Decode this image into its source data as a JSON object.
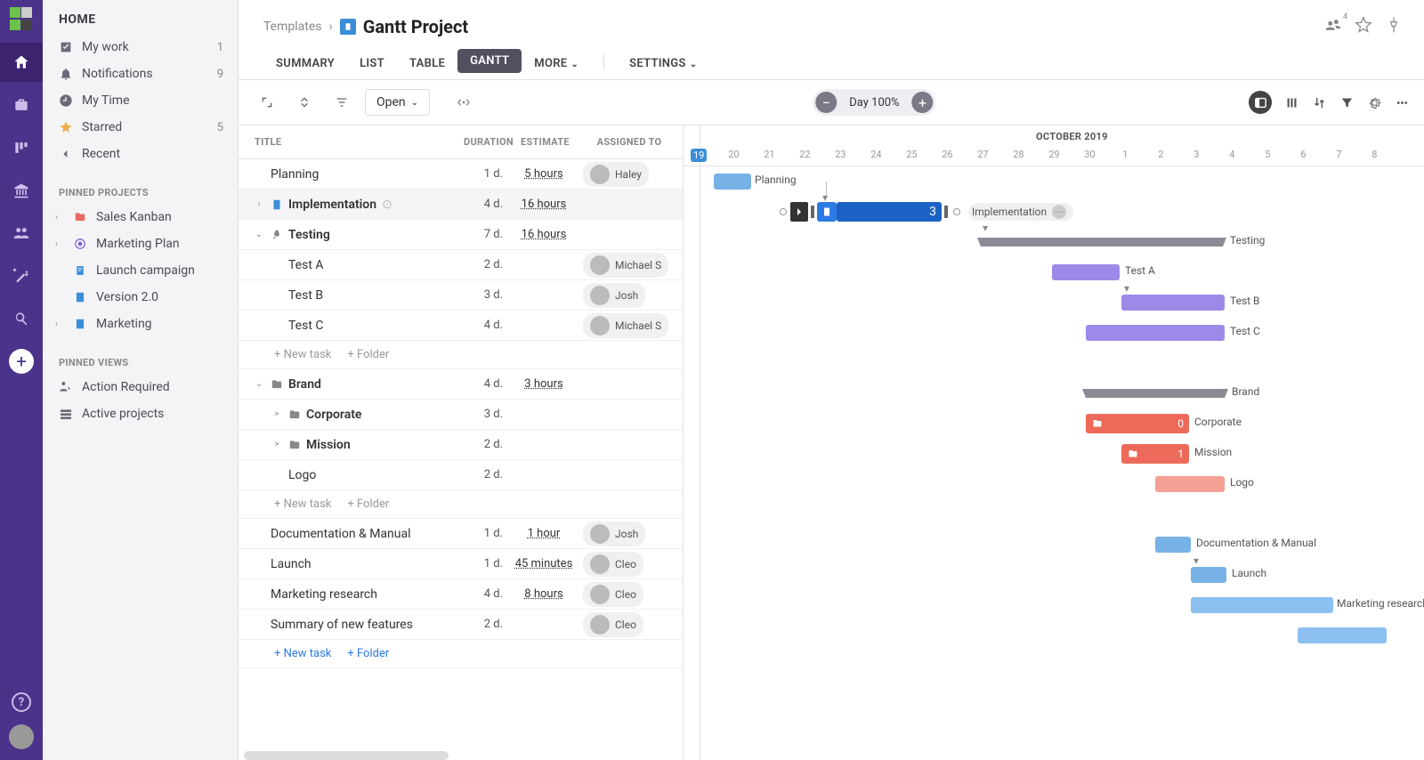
{
  "sidebar": {
    "header": "HOME",
    "main_items": [
      {
        "label": "My work",
        "count": "1"
      },
      {
        "label": "Notifications",
        "count": "9"
      },
      {
        "label": "My Time",
        "count": ""
      },
      {
        "label": "Starred",
        "count": "5"
      },
      {
        "label": "Recent",
        "count": ""
      }
    ],
    "pinned_projects_label": "PINNED PROJECTS",
    "projects": [
      {
        "label": "Sales Kanban"
      },
      {
        "label": "Marketing Plan"
      },
      {
        "label": "Launch campaign"
      },
      {
        "label": "Version 2.0"
      },
      {
        "label": "Marketing"
      }
    ],
    "pinned_views_label": "PINNED VIEWS",
    "views": [
      {
        "label": "Action Required"
      },
      {
        "label": "Active projects"
      }
    ]
  },
  "breadcrumb": {
    "templates": "Templates",
    "title": "Gantt Project",
    "share_badge": "4"
  },
  "tabs": {
    "summary": "SUMMARY",
    "list": "LIST",
    "table": "TABLE",
    "gantt": "GANTT",
    "more": "MORE",
    "settings": "SETTINGS"
  },
  "toolbar": {
    "open": "Open",
    "zoom_label": "Day 100%"
  },
  "grid": {
    "headers": {
      "title": "TITLE",
      "duration": "DURATION",
      "estimate": "ESTIMATE",
      "assigned": "ASSIGNED TO"
    },
    "newtask": "+ New task",
    "newfolder": "+ Folder"
  },
  "tasks": [
    {
      "title": "Planning",
      "dur": "1 d.",
      "est": "5 hours",
      "assignee": "Haley",
      "indent": 0,
      "type": "task"
    },
    {
      "title": "Implementation",
      "dur": "4 d.",
      "est": "16 hours",
      "assignee": "",
      "indent": 0,
      "type": "group",
      "highlight": true,
      "more": true
    },
    {
      "title": "Testing",
      "dur": "7 d.",
      "est": "16 hours",
      "assignee": "",
      "indent": 0,
      "type": "group",
      "open": true,
      "icon": "rocket"
    },
    {
      "title": "Test A",
      "dur": "2 d.",
      "est": "",
      "assignee": "Michael S",
      "indent": 1,
      "type": "task"
    },
    {
      "title": "Test B",
      "dur": "3 d.",
      "est": "",
      "assignee": "Josh",
      "indent": 1,
      "type": "task"
    },
    {
      "title": "Test C",
      "dur": "4 d.",
      "est": "",
      "assignee": "Michael S",
      "indent": 1,
      "type": "task"
    },
    {
      "title": "__newrow__"
    },
    {
      "title": "Brand",
      "dur": "4 d.",
      "est": "3 hours",
      "assignee": "",
      "indent": 0,
      "type": "group",
      "open": true,
      "icon": "folder"
    },
    {
      "title": "Corporate",
      "dur": "3 d.",
      "est": "",
      "assignee": "",
      "indent": 1,
      "type": "group",
      "icon": "folder",
      "caret": ">"
    },
    {
      "title": "Mission",
      "dur": "2 d.",
      "est": "",
      "assignee": "",
      "indent": 1,
      "type": "group",
      "icon": "folder",
      "caret": ">"
    },
    {
      "title": "Logo",
      "dur": "2 d.",
      "est": "",
      "assignee": "",
      "indent": 1,
      "type": "task"
    },
    {
      "title": "__newrow__"
    },
    {
      "title": "Documentation & Manual",
      "dur": "1 d.",
      "est": "1 hour",
      "assignee": "Josh",
      "indent": 0,
      "type": "task"
    },
    {
      "title": "Launch",
      "dur": "1 d.",
      "est": "45 minutes",
      "assignee": "Cleo",
      "indent": 0,
      "type": "task"
    },
    {
      "title": "Marketing research",
      "dur": "4 d.",
      "est": "8 hours",
      "assignee": "Cleo",
      "indent": 0,
      "type": "task"
    },
    {
      "title": "Summary of new features",
      "dur": "2 d.",
      "est": "",
      "assignee": "Cleo",
      "indent": 0,
      "type": "task"
    }
  ],
  "timeline": {
    "month": "OCTOBER 2019",
    "days": [
      "19",
      "20",
      "21",
      "22",
      "23",
      "24",
      "25",
      "26",
      "27",
      "28",
      "29",
      "30",
      "1",
      "2",
      "3",
      "4",
      "5",
      "6",
      "7",
      "8"
    ],
    "impl_label": "Implementation",
    "impl_count": "3",
    "corporate_count": "0",
    "mission_count": "1",
    "labels": {
      "planning": "Planning",
      "testing": "Testing",
      "testA": "Test A",
      "testB": "Test B",
      "testC": "Test C",
      "brand": "Brand",
      "corporate": "Corporate",
      "mission": "Mission",
      "logo": "Logo",
      "doc": "Documentation & Manual",
      "launch": "Launch",
      "marketing": "Marketing research"
    }
  }
}
